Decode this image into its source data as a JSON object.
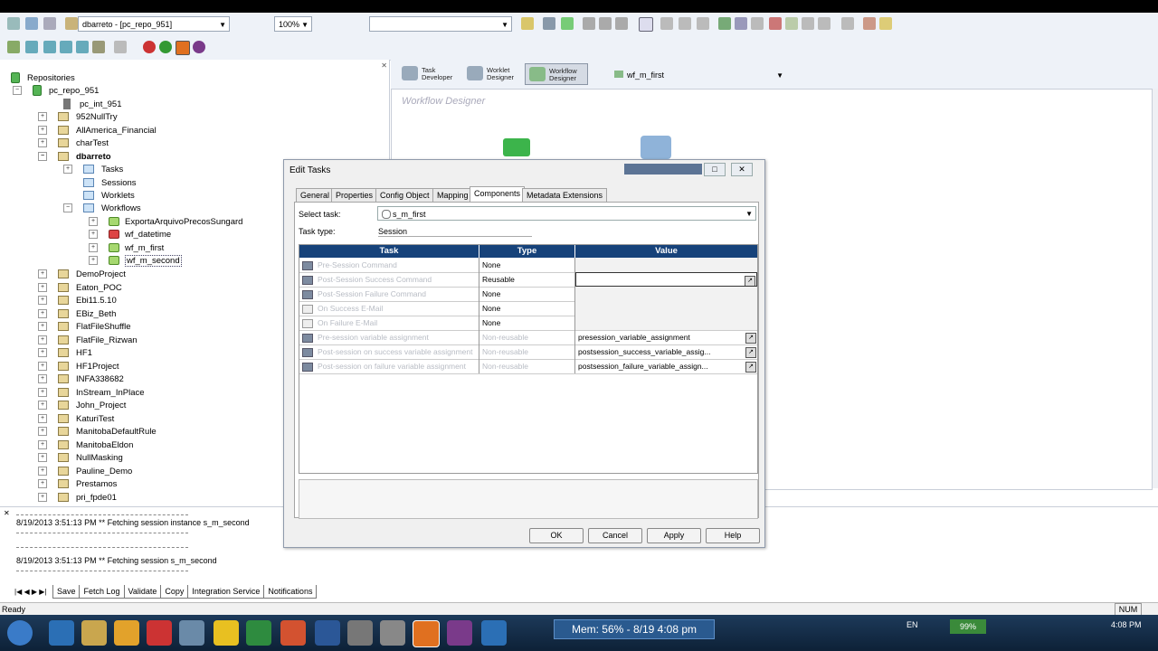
{
  "toolbar": {
    "repo_combo": "dbarreto - [pc_repo_951]",
    "zoom": "100%"
  },
  "tree": {
    "root": "Repositories",
    "repo": "pc_repo_951",
    "integration": "pc_int_951",
    "folders_a": [
      "952NullTry",
      "AllAmerica_Financial",
      "charTest"
    ],
    "open_folder": "dbarreto",
    "subfolders": [
      "Tasks",
      "Sessions",
      "Worklets",
      "Workflows"
    ],
    "workflows": [
      "ExportaArquivoPrecosSungard",
      "wf_datetime",
      "wf_m_first",
      "wf_m_second"
    ],
    "folders_b": [
      "DemoProject",
      "Eaton_POC",
      "Ebi11.5.10",
      "EBiz_Beth",
      "FlatFileShuffle",
      "FlatFile_Rizwan",
      "HF1",
      "HF1Project",
      "INFA338682",
      "InStream_InPlace",
      "John_Project",
      "KaturiTest",
      "ManitobaDefaultRule",
      "ManitobaEldon",
      "NullMasking",
      "Pauline_Demo",
      "Prestamos",
      "pri_fpde01"
    ]
  },
  "designer": {
    "tabs": [
      {
        "line1": "Task",
        "line2": "Developer"
      },
      {
        "line1": "Worklet",
        "line2": "Designer"
      },
      {
        "line1": "Workflow",
        "line2": "Designer"
      }
    ],
    "workflow_combo": "wf_m_first",
    "title": "Workflow Designer"
  },
  "output": {
    "lines": [
      "8/19/2013 3:51:13 PM ** Fetching session instance s_m_second",
      "8/19/2013 3:51:13 PM ** Fetching session s_m_second"
    ],
    "tabs": [
      "Save",
      "Fetch Log",
      "Validate",
      "Copy",
      "Integration Service",
      "Notifications"
    ]
  },
  "status": {
    "text": "Ready",
    "num": "NUM"
  },
  "taskbar": {
    "mem": "Mem: 56% - 8/19  4:08 pm",
    "lang": "EN",
    "battery": "99%",
    "clock": "4:08 PM"
  },
  "dialog": {
    "title": "Edit Tasks",
    "tabs": [
      "General",
      "Properties",
      "Config Object",
      "Mapping",
      "Components",
      "Metadata Extensions"
    ],
    "active_tab": "Components",
    "select_task_label": "Select task:",
    "select_task_value": "s_m_first",
    "task_type_label": "Task type:",
    "task_type_value": "Session",
    "columns": [
      "Task",
      "Type",
      "Value"
    ],
    "rows": [
      {
        "task": "Pre-Session Command",
        "type": "None",
        "value": ""
      },
      {
        "task": "Post-Session Success Command",
        "type": "Reusable",
        "value": ""
      },
      {
        "task": "Post-Session Failure Command",
        "type": "None",
        "value": ""
      },
      {
        "task": "On Success E-Mail",
        "type": "None",
        "value": ""
      },
      {
        "task": "On Failure E-Mail",
        "type": "None",
        "value": ""
      },
      {
        "task": "Pre-session variable assignment",
        "type": "Non-reusable",
        "value": "presession_variable_assignment"
      },
      {
        "task": "Post-session on success variable assignment",
        "type": "Non-reusable",
        "value": "postsession_success_variable_assig..."
      },
      {
        "task": "Post-session on failure variable assignment",
        "type": "Non-reusable",
        "value": "postsession_failure_variable_assign..."
      }
    ],
    "buttons": [
      "OK",
      "Cancel",
      "Apply",
      "Help"
    ]
  }
}
